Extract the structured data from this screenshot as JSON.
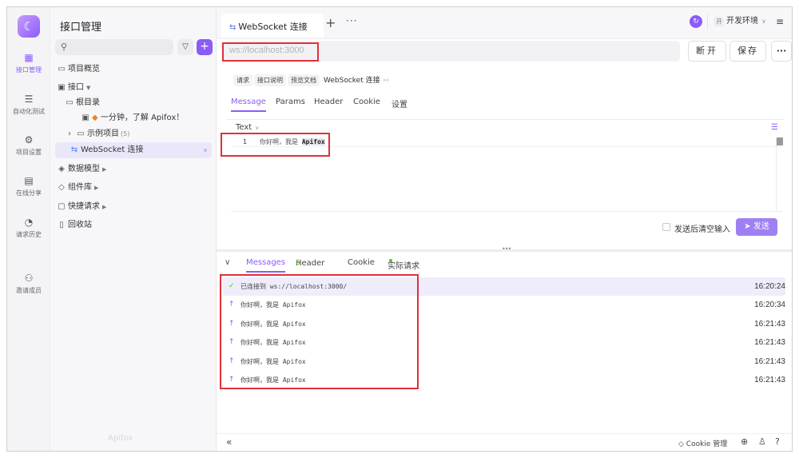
{
  "rail": {
    "items": [
      {
        "label": "接口管理",
        "icon": "api-management-icon"
      },
      {
        "label": "自动化测试",
        "icon": "automation-test-icon"
      },
      {
        "label": "项目设置",
        "icon": "project-settings-icon"
      },
      {
        "label": "在线分享",
        "icon": "share-online-icon"
      },
      {
        "label": "请求历史",
        "icon": "history-icon"
      },
      {
        "label": "邀请成员",
        "icon": "invite-member-icon"
      }
    ]
  },
  "tree": {
    "title": "接口管理",
    "overview": "项目概览",
    "apis": "接口",
    "root": "根目录",
    "intro": "一分钟，了解 Apifox！",
    "examples": "示例项目",
    "examples_count": "(5)",
    "websocket": "WebSocket 连接",
    "data_models": "数据模型",
    "components": "组件库",
    "quick_request": "快捷请求",
    "recycle": "回收站",
    "watermark": "Apifox"
  },
  "tabs": {
    "active": "WebSocket 连接",
    "env_badge": "开",
    "env_label": "开发环境"
  },
  "request": {
    "url_placeholder": "ws://localhost:3000",
    "disconnect": "断开",
    "save": "保存",
    "sub_tabs": [
      "请求",
      "接口说明",
      "预览文档"
    ],
    "doc_title": "WebSocket 连接",
    "tabs": [
      "Message",
      "Params",
      "Header",
      "Cookie",
      "设置"
    ],
    "format": "Text",
    "line_number": "1",
    "code_prefix": "你好啊，我是 ",
    "code_highlight": "Apifox",
    "clear_after_send": "发送后清空输入",
    "send": "发送"
  },
  "response": {
    "tabs": {
      "messages": "Messages",
      "header": "Header",
      "header_count": "6",
      "cookie": "Cookie",
      "actual": "实际请求"
    },
    "messages": [
      {
        "text": "已连接到 ws://localhost:3000/",
        "time": "16:20:24"
      },
      {
        "text": "你好啊，我是 Apifox",
        "time": "16:20:34"
      },
      {
        "text": "你好啊，我是 Apifox",
        "time": "16:21:43"
      },
      {
        "text": "你好啊，我是 Apifox",
        "time": "16:21:43"
      },
      {
        "text": "你好啊，我是 Apifox",
        "time": "16:21:43"
      },
      {
        "text": "你好啊，我是 Apifox",
        "time": "16:21:43"
      }
    ]
  },
  "bottom": {
    "cookie_manager": "Cookie 管理"
  },
  "colors": {
    "accent": "#8b5cf6",
    "annotation": "#e0303a",
    "success": "#52c41a"
  }
}
